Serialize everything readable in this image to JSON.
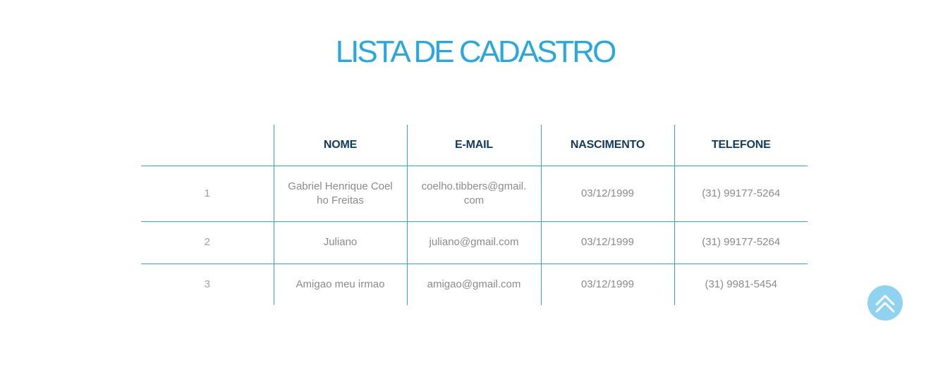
{
  "page": {
    "title": "LISTA DE CADASTRO"
  },
  "table": {
    "headers": [
      "",
      "NOME",
      "E-MAIL",
      "NASCIMENTO",
      "TELEFONE"
    ],
    "rows": [
      {
        "index": "1",
        "nome": "Gabriel Henrique Coelho Freitas",
        "email": "coelho.tibbers@gmail.com",
        "nascimento": "03/12/1999",
        "telefone": "(31) 99177-5264"
      },
      {
        "index": "2",
        "nome": "Juliano",
        "email": "juliano@gmail.com",
        "nascimento": "03/12/1999",
        "telefone": "(31) 99177-5264"
      },
      {
        "index": "3",
        "nome": "Amigao meu irmao",
        "email": "amigao@gmail.com",
        "nascimento": "03/12/1999",
        "telefone": "(31) 9981-5454"
      }
    ]
  },
  "scroll_top_button": {
    "icon": "double-chevron-up-icon"
  },
  "colors": {
    "accent": "#29a8e0",
    "header_text": "#103a5e",
    "cell_text": "#8b8b8b",
    "border": "#3aa3d8",
    "scroll_button": "#8fd3f0"
  }
}
